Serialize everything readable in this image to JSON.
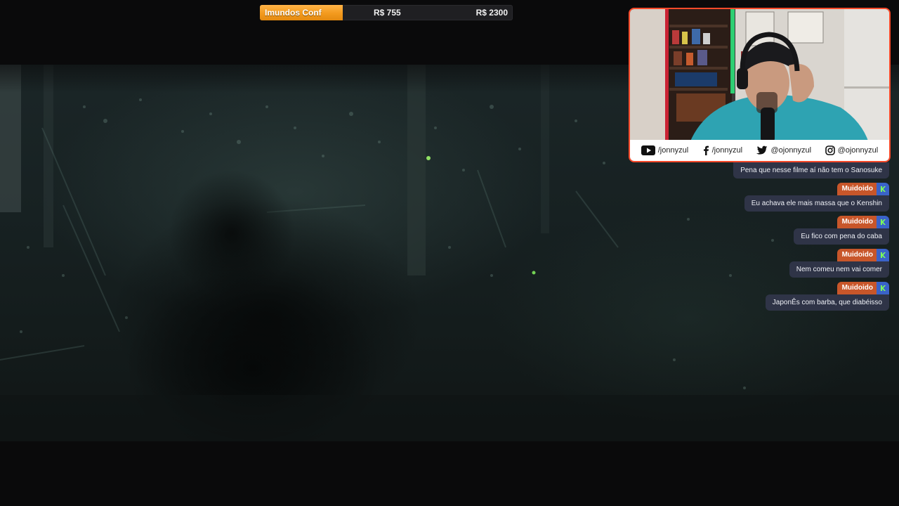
{
  "goal": {
    "label": "Imundos Conf",
    "current": "R$ 755",
    "target": "R$ 2300",
    "progress": 0.328,
    "fill_color": "#f39a1e"
  },
  "webcam": {
    "frame_color": "#ff4a2a",
    "socials": [
      {
        "icon": "youtube-icon",
        "handle": "/jonnyzul"
      },
      {
        "icon": "facebook-icon",
        "handle": "/jonnyzul"
      },
      {
        "icon": "twitter-icon",
        "handle": "@ojonnyzul"
      },
      {
        "icon": "instagram-icon",
        "handle": "@ojonnyzul"
      }
    ]
  },
  "chat": {
    "messages": [
      {
        "user": "",
        "text": "Pena que nesse filme aí não tem o Sanosuke"
      },
      {
        "user": "Muidoido",
        "text": "Eu achava ele mais massa que o Kenshin"
      },
      {
        "user": "Muidoido",
        "text": "Eu fico com pena do caba"
      },
      {
        "user": "Muidoido",
        "text": "Nem comeu nem vai comer"
      },
      {
        "user": "Muidoido",
        "text": "JaponÊs com barba, que diabéisso"
      }
    ],
    "user_tag_color": "#c8562a",
    "bubble_color": "#2f3447"
  }
}
